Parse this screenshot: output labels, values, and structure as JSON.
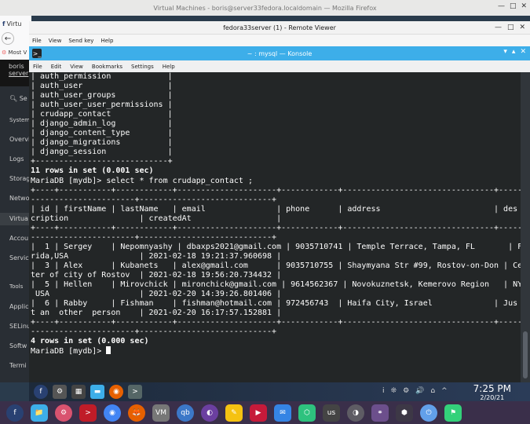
{
  "firefox": {
    "title": "Virtual Machines - boris@server33fedora.localdomain — Mozilla Firefox",
    "tab_label": "Virtu",
    "bookmark": "Most V"
  },
  "cockpit": {
    "host_user": "boris",
    "host_name": "server",
    "search_placeholder": "Se",
    "items": [
      "System",
      "Overvi",
      "Logs",
      "Storag",
      "Netwo",
      "Virtua",
      "Accou",
      "Servic",
      "Tools",
      "Applic",
      "SELinu",
      "Softw",
      "Termi"
    ]
  },
  "remote_viewer": {
    "title": "fedora33server (1) - Remote Viewer",
    "menu": [
      "File",
      "View",
      "Send key",
      "Help"
    ]
  },
  "konsole": {
    "title": "~ : mysql — Konsole",
    "menu": [
      "File",
      "Edit",
      "View",
      "Bookmarks",
      "Settings",
      "Help"
    ]
  },
  "terminal": {
    "lines": [
      "| auth_permission            |",
      "| auth_user                  |",
      "| auth_user_groups           |",
      "| auth_user_user_permissions |",
      "| crudapp_contact            |",
      "| django_admin_log           |",
      "| django_content_type        |",
      "| django_migrations          |",
      "| django_session             |",
      "+----------------------------+",
      "11 rows in set (0.001 sec)",
      "",
      "MariaDB [mydb]> select * from crudapp_contact ;",
      "+----+-----------+------------+---------------------+------------+--------------------------------+-----",
      "----------------------+----------------------------+",
      "| id | firstName | lastName   | email               | phone      | address                        | des",
      "cription               | createdAt                  |",
      "+----+-----------+------------+---------------------+------------+--------------------------------+-----",
      "----------------------+----------------------------+",
      "|  1 | Sergey    | Nepomnyashy | dbaxps2021@gmail.com | 9035710741 | Temple Terrace, Tampa, FL       | Flo",
      "rida,USA               | 2021-02-18 19:21:37.960698 |",
      "|  3 | Alex      | Kubanets   | alex@gmail.com      | 9035710755 | Shaymyana Str #99, Rostov-on-Don | Cen",
      "ter of city of Rostov  | 2021-02-18 19:56:20.734432 |",
      "|  5 | Hellen    | Mirovchick | mironchick@gmail.com | 9614562367 | Novokuznetsk, Kemerovo Region   | NY,",
      " USA                   | 2021-02-20 14:39:26.801406 |",
      "|  6 | Rabby     | Fishman    | fishman@hotmail.com | 972456743  | Haifa City, Israel             | Jus",
      "t an  other  person    | 2021-02-20 16:17:57.152881 |",
      "+----+-----------+------------+---------------------+------------+--------------------------------+-----",
      "----------------------+----------------------------+",
      "4 rows in set (0.000 sec)",
      "",
      "MariaDB [mydb]> "
    ]
  },
  "panel": {
    "time": "7:25 PM",
    "date": "2/20/21",
    "tray": [
      "i",
      "❊",
      "⚙",
      "🔊",
      "⌂",
      "^"
    ]
  },
  "dock": {
    "labels": [
      "f",
      "📁",
      "⚙",
      ">",
      "◉",
      "🦊",
      "VM",
      "qb",
      "◐",
      "✎",
      "▶",
      "✉",
      "⬡",
      "us",
      "◑",
      "⚭",
      "⬢",
      "⏻",
      "⚑"
    ]
  },
  "colors": {
    "konsole_titlebar": "#3daee9",
    "terminal_bg": "#232627",
    "terminal_fg": "#fcfcfc"
  }
}
